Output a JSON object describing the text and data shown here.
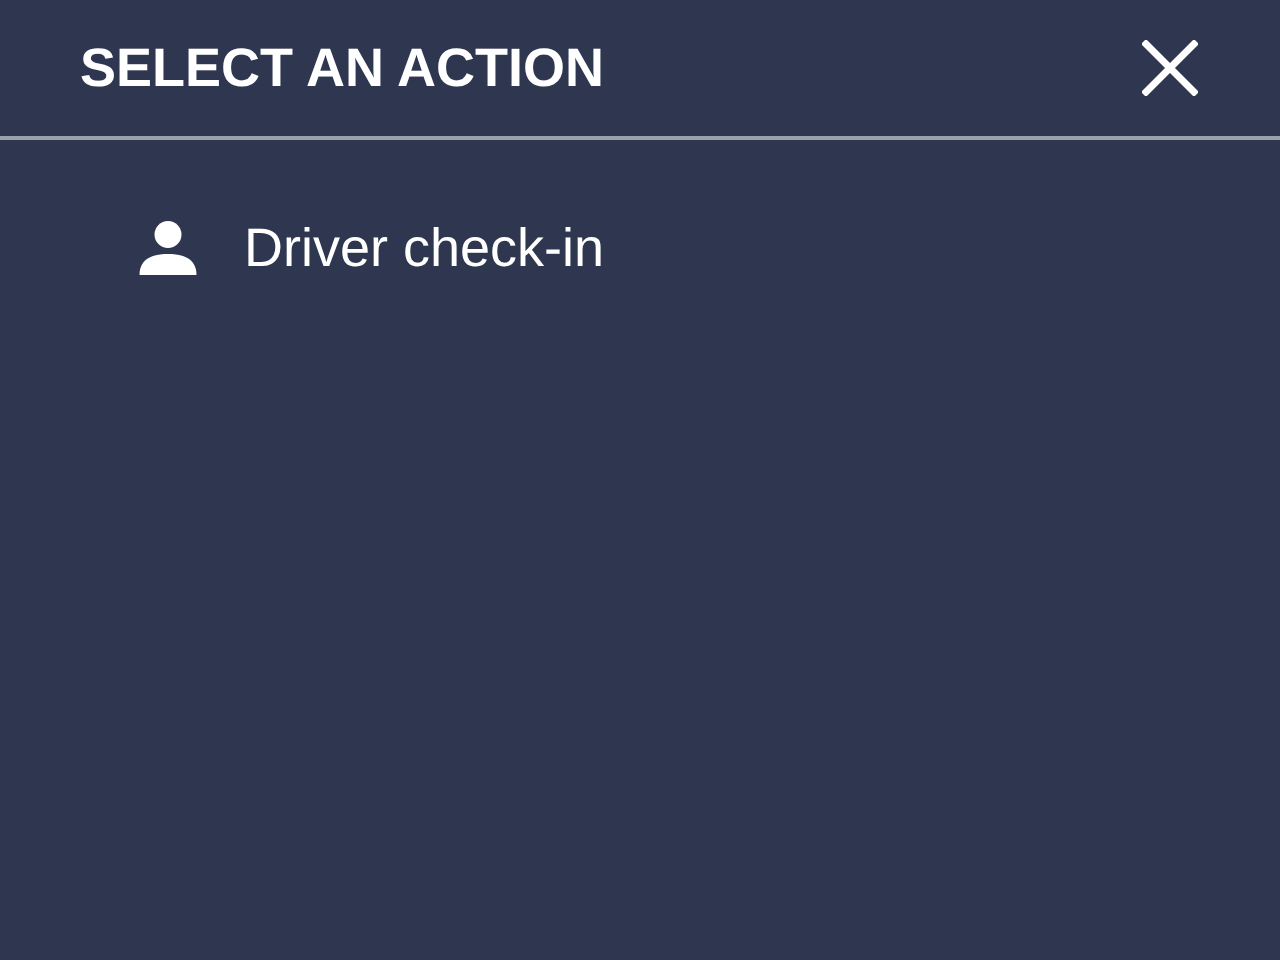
{
  "header": {
    "title": "SELECT AN ACTION"
  },
  "actions": [
    {
      "label": "Driver check-in"
    }
  ]
}
